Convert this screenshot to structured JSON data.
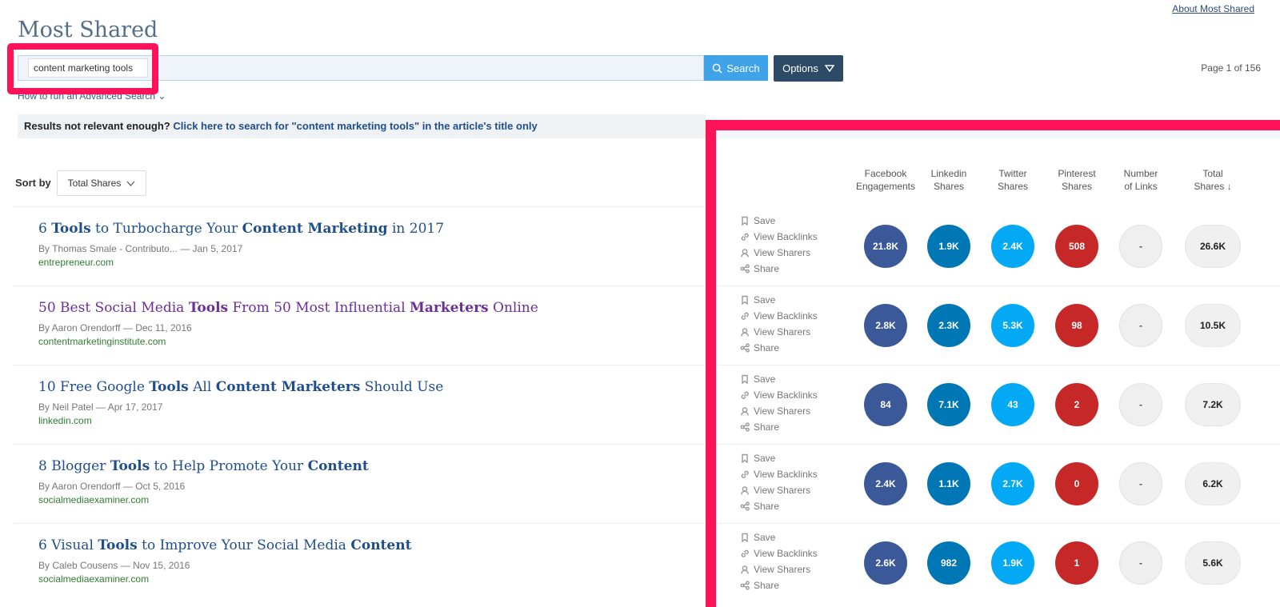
{
  "header": {
    "title": "Most Shared",
    "about_link": "About Most Shared"
  },
  "search": {
    "query": "content marketing tools",
    "button_label": "Search",
    "options_label": "Options",
    "page_info": "Page 1 of 156",
    "advanced_link": "How to run an Advanced Search"
  },
  "relevance": {
    "prefix": "Results not relevant enough?",
    "link": "Click here to search for \"content marketing tools\" in the article's title only"
  },
  "sort": {
    "label": "Sort by",
    "value": "Total Shares"
  },
  "columns": [
    {
      "line1": "Facebook",
      "line2": "Engagements"
    },
    {
      "line1": "Linkedin",
      "line2": "Shares"
    },
    {
      "line1": "Twitter",
      "line2": "Shares"
    },
    {
      "line1": "Pinterest",
      "line2": "Shares"
    },
    {
      "line1": "Number",
      "line2": "of Links"
    },
    {
      "line1": "Total",
      "line2": "Shares ↓"
    }
  ],
  "actions": {
    "save": "Save",
    "view_backlinks": "View Backlinks",
    "view_sharers": "View Sharers",
    "share": "Share"
  },
  "articles": [
    {
      "title_parts": [
        {
          "t": "6 ",
          "b": false
        },
        {
          "t": "Tools",
          "b": true
        },
        {
          "t": " to Turbocharge Your ",
          "b": false
        },
        {
          "t": "Content Marketing",
          "b": true
        },
        {
          "t": " in 2017",
          "b": false
        }
      ],
      "visited": false,
      "author": "By Thomas Smale - Contributo...",
      "date": "Jan 5, 2017",
      "domain": "entrepreneur.com",
      "facebook": "21.8K",
      "linkedin": "1.9K",
      "twitter": "2.4K",
      "pinterest": "508",
      "links": "-",
      "total": "26.6K"
    },
    {
      "title_parts": [
        {
          "t": "50 Best Social Media ",
          "b": false
        },
        {
          "t": "Tools",
          "b": true
        },
        {
          "t": " From 50 Most Influential ",
          "b": false
        },
        {
          "t": "Marketers",
          "b": true
        },
        {
          "t": " Online",
          "b": false
        }
      ],
      "visited": true,
      "author": "By Aaron Orendorff",
      "date": "Dec 11, 2016",
      "domain": "contentmarketinginstitute.com",
      "facebook": "2.8K",
      "linkedin": "2.3K",
      "twitter": "5.3K",
      "pinterest": "98",
      "links": "-",
      "total": "10.5K"
    },
    {
      "title_parts": [
        {
          "t": "10 Free Google ",
          "b": false
        },
        {
          "t": "Tools",
          "b": true
        },
        {
          "t": " All ",
          "b": false
        },
        {
          "t": "Content Marketers",
          "b": true
        },
        {
          "t": " Should Use",
          "b": false
        }
      ],
      "visited": false,
      "author": "By Neil Patel",
      "date": "Apr 17, 2017",
      "domain": "linkedin.com",
      "facebook": "84",
      "linkedin": "7.1K",
      "twitter": "43",
      "pinterest": "2",
      "links": "-",
      "total": "7.2K"
    },
    {
      "title_parts": [
        {
          "t": "8 Blogger ",
          "b": false
        },
        {
          "t": "Tools",
          "b": true
        },
        {
          "t": " to Help Promote Your ",
          "b": false
        },
        {
          "t": "Content",
          "b": true
        }
      ],
      "visited": false,
      "author": "By Aaron Orendorff",
      "date": "Oct 5, 2016",
      "domain": "socialmediaexaminer.com",
      "facebook": "2.4K",
      "linkedin": "1.1K",
      "twitter": "2.7K",
      "pinterest": "0",
      "links": "-",
      "total": "6.2K"
    },
    {
      "title_parts": [
        {
          "t": "6 Visual ",
          "b": false
        },
        {
          "t": "Tools",
          "b": true
        },
        {
          "t": " to Improve Your Social Media ",
          "b": false
        },
        {
          "t": "Content",
          "b": true
        }
      ],
      "visited": false,
      "author": "By Caleb Cousens",
      "date": "Nov 15, 2016",
      "domain": "socialmediaexaminer.com",
      "facebook": "2.6K",
      "linkedin": "982",
      "twitter": "1.9K",
      "pinterest": "1",
      "links": "-",
      "total": "5.6K"
    }
  ],
  "colors": {
    "highlight": "#ff1358",
    "facebook": "#3b5998",
    "linkedin": "#0077b5",
    "twitter": "#03a9f4",
    "pinterest": "#c62828"
  }
}
